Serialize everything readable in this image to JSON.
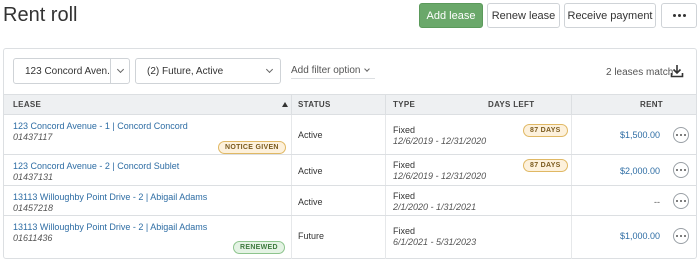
{
  "header": {
    "title": "Rent roll",
    "add_lease": "Add lease",
    "renew_lease": "Renew lease",
    "receive_payment": "Receive payment"
  },
  "filters": {
    "property": "123 Concord Aven...",
    "status": "(2) Future, Active",
    "add_filter": "Add filter option",
    "match_count": "2 leases match"
  },
  "table": {
    "headers": [
      "LEASE",
      "STATUS",
      "TYPE",
      "DAYS LEFT",
      "RENT"
    ],
    "rows": [
      {
        "lease": "123 Concord Avenue - 1 | Concord Concord",
        "id": "01437117",
        "badge": "NOTICE GIVEN",
        "status": "Active",
        "type": "Fixed",
        "dates": "12/6/2019 - 12/31/2020",
        "days_left": "87 DAYS",
        "rent": "$1,500.00"
      },
      {
        "lease": "123 Concord Avenue - 2 | Concord Sublet",
        "id": "01437131",
        "badge": "",
        "status": "Active",
        "type": "Fixed",
        "dates": "12/6/2019 - 12/31/2020",
        "days_left": "87 DAYS",
        "rent": "$2,000.00"
      },
      {
        "lease": "13113 Willoughby Point Drive - 2 | Abigail Adams",
        "id": "01457218",
        "badge": "",
        "status": "Active",
        "type": "Fixed",
        "dates": "2/1/2020 - 1/31/2021",
        "days_left": "",
        "rent": "--"
      },
      {
        "lease": "13113 Willoughby Point Drive - 2 | Abigail Adams",
        "id": "01611436",
        "badge": "RENEWED",
        "status": "Future",
        "type": "Fixed",
        "dates": "6/1/2021 - 5/31/2023",
        "days_left": "",
        "rent": "$1,000.00"
      }
    ]
  },
  "icons": {
    "more": "ellipsis-icon",
    "download": "download-icon",
    "sort": "sort-asc-icon",
    "chevron": "chevron-down-icon"
  },
  "colors": {
    "primary": "#6aa86a",
    "link": "#2e6da4",
    "notice": "#fdf1dc",
    "renewed": "#e4f3e4"
  }
}
